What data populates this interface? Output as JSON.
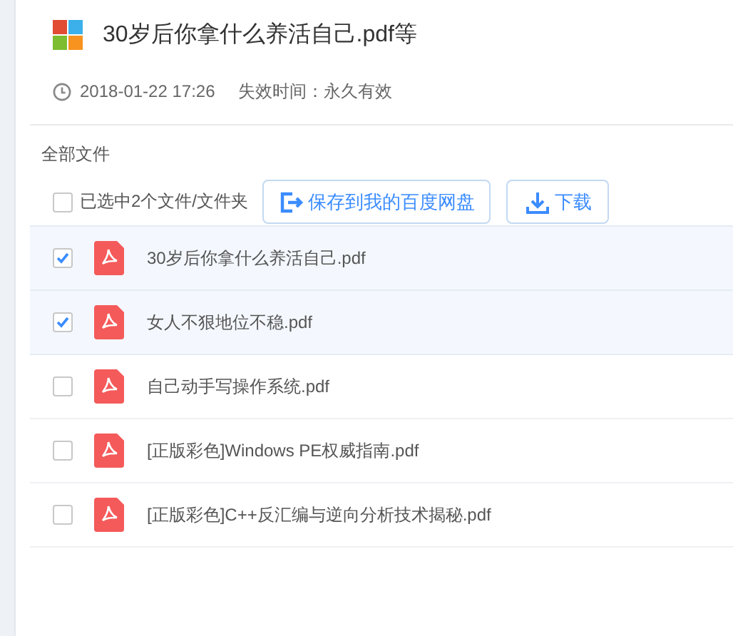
{
  "share": {
    "title": "30岁后你拿什么养活自己.pdf等",
    "date": "2018-01-22 17:26",
    "expiry": "失效时间：永久有效"
  },
  "breadcrumb": "全部文件",
  "toolbar": {
    "select_all": {
      "label": "已选中2个文件/文件夹",
      "checked": false
    },
    "buttons": [
      {
        "label": "保存到我的百度网盘",
        "kind": "save"
      },
      {
        "label": "下载",
        "kind": "download"
      }
    ]
  },
  "files": [
    {
      "name": "30岁后你拿什么养活自己.pdf",
      "selected": true
    },
    {
      "name": "女人不狠地位不稳.pdf",
      "selected": true
    },
    {
      "name": "自己动手写操作系统.pdf",
      "selected": false
    },
    {
      "name": "[正版彩色]Windows PE权威指南.pdf",
      "selected": false
    },
    {
      "name": "[正版彩色]C++反汇编与逆向分析技术揭秘.pdf",
      "selected": false
    }
  ]
}
